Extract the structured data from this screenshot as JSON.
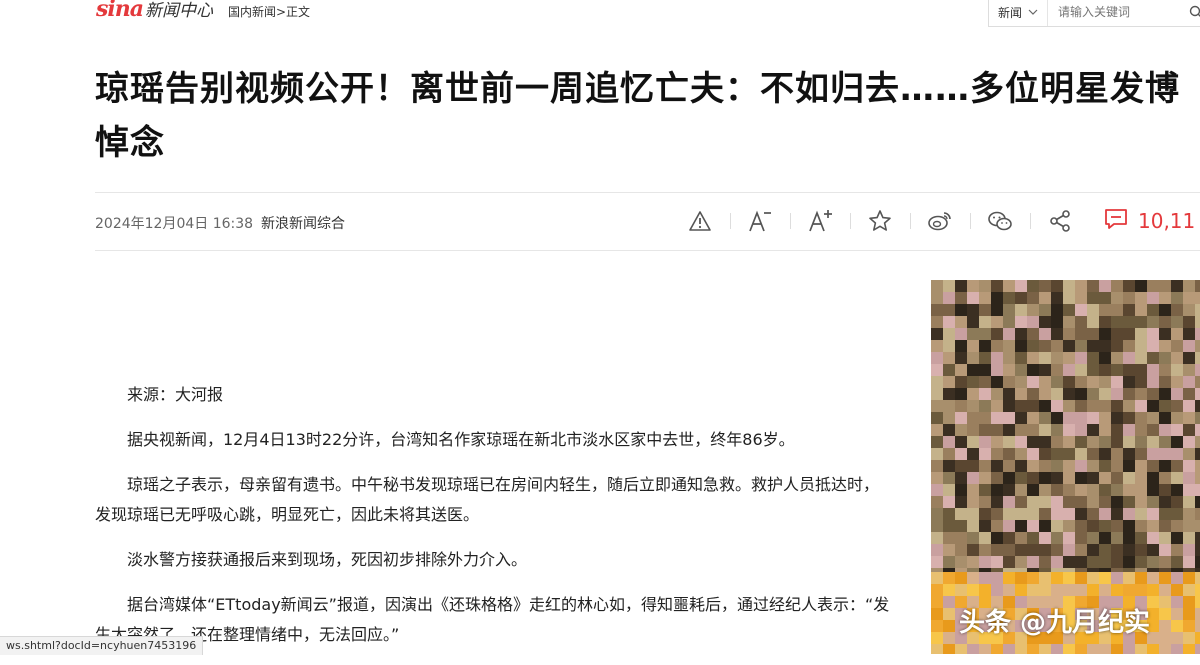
{
  "header": {
    "logo_sina": "sina",
    "logo_news": "新闻中心",
    "breadcrumb": "国内新闻>正文",
    "search": {
      "category": "新闻",
      "placeholder": "请输入关键词"
    }
  },
  "article": {
    "title": "琼瑶告别视频公开！离世前一周追忆亡夫：不如归去……多位明星发博悼念",
    "date": "2024年12月04日 16:38",
    "source": "新浪新闻综合",
    "comment_count": "10,11",
    "paragraphs": [
      "来源：大河报",
      "据央视新闻，12月4日13时22分许，台湾知名作家琼瑶在新北市淡水区家中去世，终年86岁。",
      "琼瑶之子表示，母亲留有遗书。中午秘书发现琼瑶已在房间内轻生，随后立即通知急救。救护人员抵达时，发现琼瑶已无呼吸心跳，明显死亡，因此未将其送医。",
      "淡水警方接获通报后来到现场，死因初步排除外力介入。",
      "据台湾媒体“ETtoday新闻云”报道，因演出《还珠格格》走红的林心如，得知噩耗后，通过经纪人表示：“发生太突然了，还在整理情绪中，无法回应。”"
    ]
  },
  "toolbar": {
    "icons": [
      "warning-icon",
      "font-decrease-icon",
      "font-increase-icon",
      "star-icon",
      "weibo-icon",
      "wechat-icon",
      "share-icon",
      "comment-icon"
    ]
  },
  "sidebar": {
    "watermark": "头条 @九月纪实"
  },
  "status_bar": {
    "url": "ws.shtml?docId=ncyhuen7453196"
  },
  "colors": {
    "accent": "#e4393c",
    "text": "#222222",
    "muted": "#666666"
  }
}
